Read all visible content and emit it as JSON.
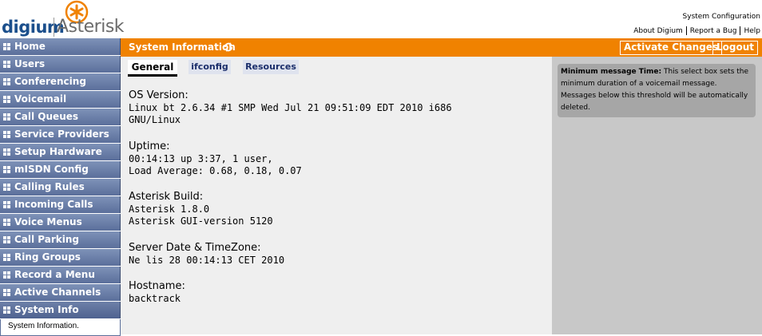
{
  "brand": {
    "left": "digium",
    "right": "Asterisk"
  },
  "topnav": {
    "title": "System Configuration",
    "links": [
      "About Digium",
      "Report a Bug",
      "Help"
    ]
  },
  "sidebar": {
    "items": [
      {
        "label": "Home"
      },
      {
        "label": "Users"
      },
      {
        "label": "Conferencing"
      },
      {
        "label": "Voicemail"
      },
      {
        "label": "Call Queues"
      },
      {
        "label": "Service Providers"
      },
      {
        "label": "Setup Hardware"
      },
      {
        "label": "mISDN Config"
      },
      {
        "label": "Calling Rules"
      },
      {
        "label": "Incoming Calls"
      },
      {
        "label": "Voice Menus"
      },
      {
        "label": "Call Parking"
      },
      {
        "label": "Ring Groups"
      },
      {
        "label": "Record a Menu"
      },
      {
        "label": "Active Channels"
      },
      {
        "label": "System Info"
      }
    ],
    "active_description": "System Information."
  },
  "mainbar": {
    "title": "System Information",
    "activate_label": "Activate Changes",
    "logout_label": "Logout"
  },
  "tabs": {
    "general": "General",
    "ifconfig": "ifconfig",
    "resources": "Resources"
  },
  "info": {
    "os_label": "OS Version:",
    "os_value": "Linux bt 2.6.34 #1 SMP Wed Jul 21 09:51:09 EDT 2010 i686\nGNU/Linux",
    "uptime_label": "Uptime:",
    "uptime_value": "00:14:13 up 3:37, 1 user,\nLoad Average: 0.68, 0.18, 0.07",
    "build_label": "Asterisk Build:",
    "build_value": "Asterisk 1.8.0\nAsterisk GUI-version 5120",
    "date_label": "Server Date & TimeZone:",
    "date_value": "Ne lis 28 00:14:13 CET 2010",
    "host_label": "Hostname:",
    "host_value": "backtrack"
  },
  "help": {
    "title": "Minimum message Time:",
    "text": "This select box sets the minimum duration of a voicemail message. Messages below this threshold will be automatically deleted."
  },
  "colors": {
    "accent": "#f08200",
    "nav": "#5b6f9b",
    "brand_blue": "#1b4f8c"
  }
}
